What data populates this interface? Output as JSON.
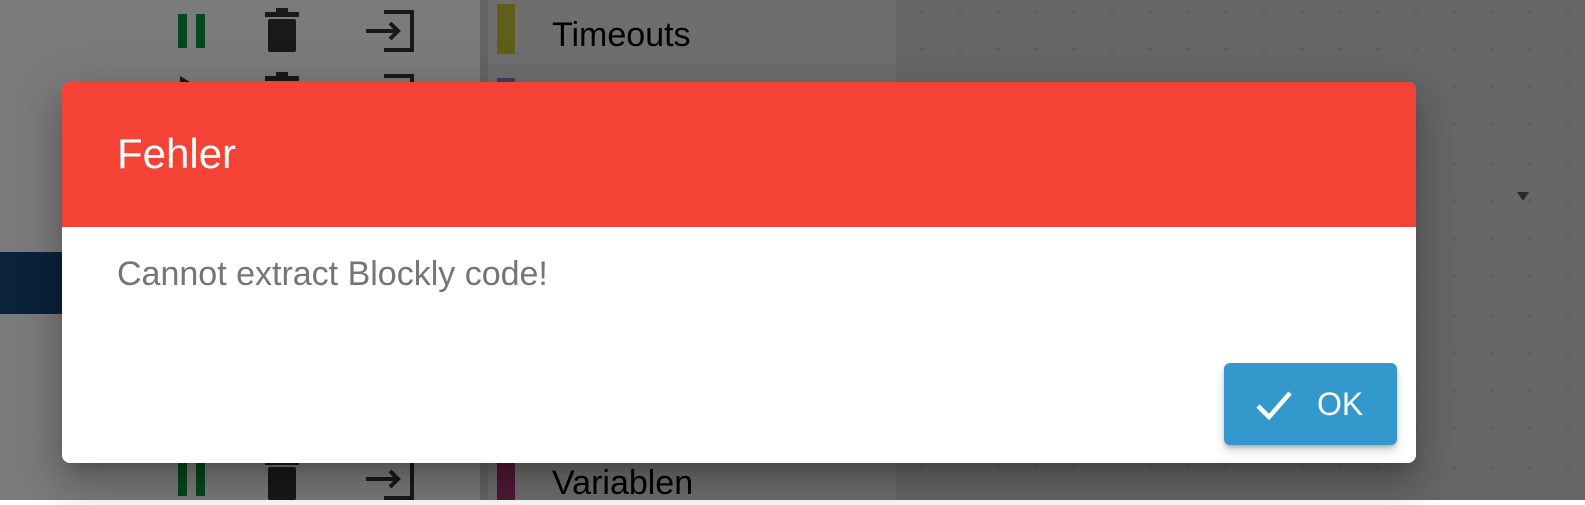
{
  "colors": {
    "header_red": "#f44336",
    "ok_blue": "#3399cc",
    "pause_green": "#0a8f3c",
    "icon_dark": "#333333",
    "selection_navy": "#164477"
  },
  "toolbox": {
    "items": [
      {
        "label": "Timeouts",
        "color": "#bfbf35"
      },
      {
        "label": "",
        "color": "#7a7ad0"
      },
      {
        "label": "Variablen",
        "color": "#a5316c"
      }
    ]
  },
  "left_pane": {
    "row_icons": [
      "pause-icon",
      "trash-icon",
      "export-icon",
      "play-icon"
    ]
  },
  "dialog": {
    "title": "Fehler",
    "message": "Cannot extract Blockly code!",
    "ok_label": "OK",
    "ok_icon": "check-icon"
  }
}
